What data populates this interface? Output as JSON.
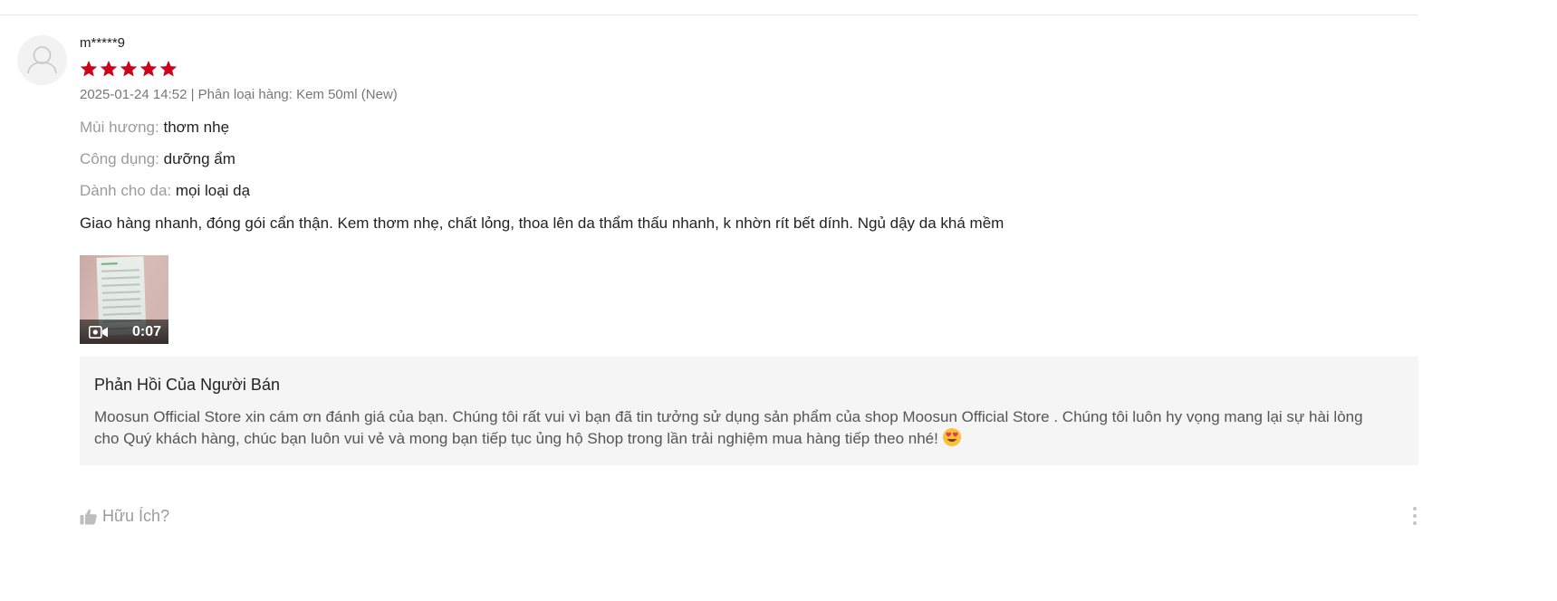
{
  "review": {
    "username": "m*****9",
    "rating": 5,
    "rating_color": "#d0011b",
    "meta": "2025-01-24 14:52 | Phân loại hàng: Kem 50ml (New)",
    "attributes": [
      {
        "key": "Mùi hương:",
        "value": "thơm nhẹ"
      },
      {
        "key": "Công dụng:",
        "value": "dưỡng ẩm"
      },
      {
        "key": "Dành cho da:",
        "value": "mọi loại dạ"
      }
    ],
    "text": "Giao hàng nhanh, đóng gói cẩn thận. Kem thơm nhẹ, chất lỏng, thoa lên da thẩm thấu nhanh, k nhờn rít bết dính. Ngủ dậy da khá mềm",
    "media": {
      "type_icon": "video-camera-icon",
      "duration": "0:07"
    }
  },
  "seller_reply": {
    "title": "Phản Hồi Của Người Bán",
    "text": "Moosun Official Store xin cám ơn đánh giá của bạn. Chúng tôi rất vui vì bạn đã tin tưởng sử dụng sản phẩm của shop Moosun Official Store . Chúng tôi luôn hy vọng mang lại sự hài lòng cho Quý khách hàng, chúc bạn luôn vui vẻ và mong bạn tiếp tục ủng hộ Shop trong lần trải nghiệm mua hàng tiếp theo nhé!",
    "emoji_icon": "heart-eyes-emoji-icon"
  },
  "actions": {
    "helpful_label": "Hữu Ích?",
    "helpful_icon": "thumbs-up-icon",
    "more_icon": "vertical-dots-icon"
  }
}
